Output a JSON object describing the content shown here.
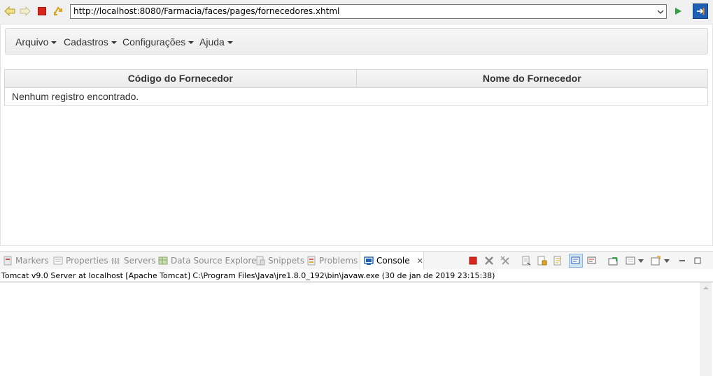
{
  "browser": {
    "url": "http://localhost:8080/Farmacia/faces/pages/fornecedores.xhtml",
    "icons": [
      "back-icon",
      "forward-icon",
      "stop-icon",
      "refresh-icon",
      "dropdown-icon",
      "go-icon",
      "external-browser-icon"
    ]
  },
  "menubar": {
    "items": [
      {
        "label": "Arquivo"
      },
      {
        "label": "Cadastros"
      },
      {
        "label": "Configurações"
      },
      {
        "label": "Ajuda"
      }
    ]
  },
  "table": {
    "columns": [
      "Código do Fornecedor",
      "Nome do Fornecedor"
    ],
    "empty_message": "Nenhum registro encontrado."
  },
  "panel": {
    "tabs": [
      {
        "label": "Markers",
        "icon": "markers-icon"
      },
      {
        "label": "Properties",
        "icon": "properties-icon"
      },
      {
        "label": "Servers",
        "icon": "servers-icon"
      },
      {
        "label": "Data Source Explorer",
        "icon": "data-source-icon"
      },
      {
        "label": "Snippets",
        "icon": "snippets-icon"
      },
      {
        "label": "Problems",
        "icon": "problems-icon"
      },
      {
        "label": "Console",
        "icon": "console-icon",
        "active": true
      }
    ],
    "close_symbol": "✕",
    "console_title": "Tomcat v9.0 Server at localhost [Apache Tomcat] C:\\Program Files\\Java\\jre1.8.0_192\\bin\\javaw.exe (30 de jan de 2019 23:15:38)"
  },
  "colors": {
    "accent_blue": "#1c5fb4",
    "stop_red": "#d9261c",
    "go_green": "#2ea043"
  }
}
